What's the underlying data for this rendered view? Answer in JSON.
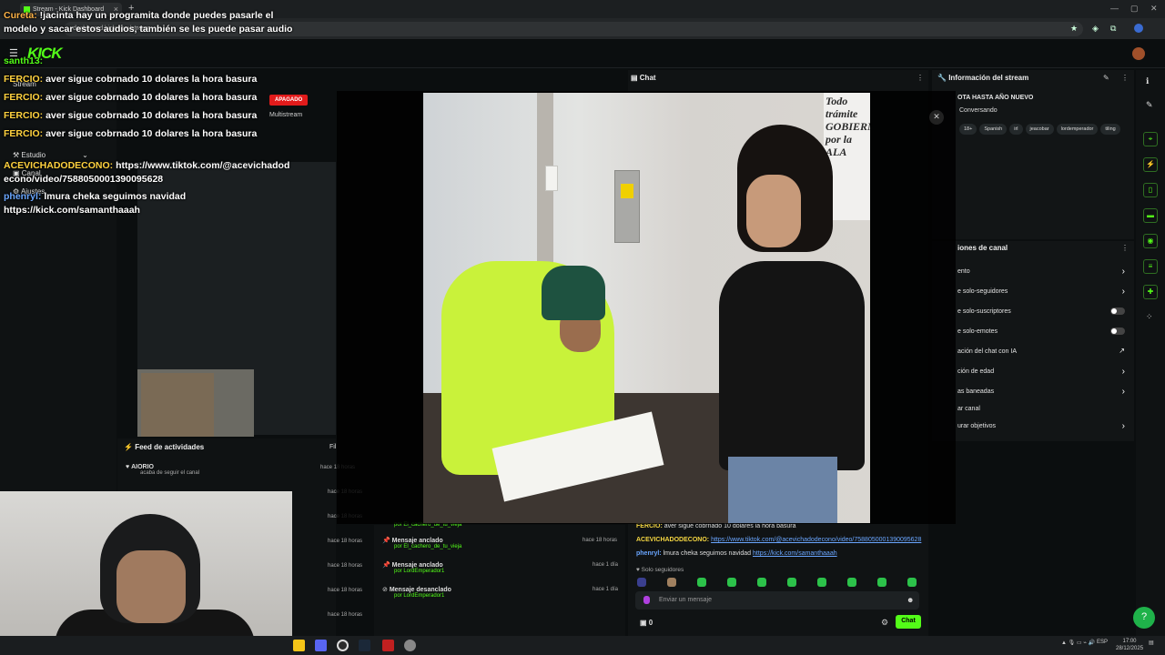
{
  "browser": {
    "tab_title": "Stream - Kick Dashboard",
    "url": "dashboard.kick.com/stream",
    "window_controls": [
      "—",
      "▢",
      "✕"
    ]
  },
  "kick": {
    "logo": "KICK",
    "sidebar": [
      {
        "label": "Stream"
      },
      {
        "label": "Estudio"
      },
      {
        "label": "Canal"
      },
      {
        "label": "Ajustes"
      }
    ],
    "status_badge": "APAGADO",
    "multistream_label": "Multistream",
    "activity_feed": {
      "title": "Feed de actividades",
      "filter": "Fil",
      "items": [
        {
          "name": "AIORIO",
          "desc": "acaba de seguir el canal",
          "time": "hace 18 horas"
        },
        {
          "name": "",
          "desc": "",
          "time": "hace 18 horas"
        },
        {
          "name": "",
          "desc": "",
          "time": "hace 18 horas"
        },
        {
          "name": "",
          "desc": "",
          "time": "hace 18 horas"
        },
        {
          "name": "",
          "desc": "",
          "time": "hace 18 horas"
        },
        {
          "name": "",
          "desc": "",
          "time": "hace 18 horas"
        },
        {
          "name": "",
          "desc": "",
          "time": "hace 18 horas"
        }
      ]
    },
    "pinned": [
      {
        "title": "",
        "by": "por El_cachero_de_tu_vieja",
        "time": ""
      },
      {
        "title": "Mensaje anclado",
        "by": "por El_cachero_de_tu_vieja",
        "time": "hace 18 horas"
      },
      {
        "title": "Mensaje anclado",
        "by": "por LordEmperador1",
        "time": "hace 1 día"
      },
      {
        "title": "Mensaje desanclado",
        "by": "por LordEmperador1",
        "time": "hace 1 día"
      }
    ],
    "chat": {
      "title": "Chat",
      "lines": [
        {
          "user": "FERCIO:",
          "text": " aver sigue cobrnado 10 dolares la hora basura",
          "link": ""
        },
        {
          "user": "ACEVICHADODECONO:",
          "text": " ",
          "link": "https://www.tiktok.com/@acevichadodecono/video/7588050001390095628"
        },
        {
          "user": "phenryl:",
          "text": " lmura cheka seguimos navidad ",
          "link": "https://kick.com/samanthaaah"
        }
      ],
      "mode": "Solo seguidores",
      "input_placeholder": "Enviar un mensaje",
      "count": "0",
      "send_button": "Chat"
    },
    "stream_info": {
      "title": "Información del stream",
      "stream_title": "OTA HASTA AÑO NUEVO",
      "category": "Conversando",
      "tags": [
        "18+",
        "Spanish",
        "irl",
        "jeacobar",
        "lordemperador",
        "tiling"
      ]
    },
    "channel_settings": {
      "title": "iones de canal",
      "rows": [
        {
          "label": "ento",
          "control": "chevron"
        },
        {
          "label": "e solo-seguidores",
          "control": "chevron"
        },
        {
          "label": "e solo-suscriptores",
          "control": "toggle"
        },
        {
          "label": "e solo-emotes",
          "control": "toggle"
        },
        {
          "label": "ación del chat con IA",
          "control": "external"
        },
        {
          "label": "ción de edad",
          "control": "chevron"
        },
        {
          "label": "as baneadas",
          "control": "chevron"
        },
        {
          "label": "ar canal",
          "control": "none"
        },
        {
          "label": "urar objetivos",
          "control": "chevron"
        }
      ]
    }
  },
  "modal": {
    "close": "✕",
    "poster_text": "Todo trámite GOBIERNO por la ALA"
  },
  "overlay_chat": [
    {
      "user": "Cureta:",
      "text": " !jacinta hay un programita donde puedes pasarle el modelo y sacar estos audios, también se les puede pasar audio",
      "cls": "n1"
    },
    {
      "user": "santh13:",
      "text": "",
      "cls": "n4"
    },
    {
      "user": "FERCIO:",
      "text": " aver sigue cobrnado 10 dolares la hora basura",
      "cls": "n2"
    },
    {
      "user": "FERCIO:",
      "text": " aver sigue cobrnado 10 dolares la hora basura",
      "cls": "n2"
    },
    {
      "user": "FERCIO:",
      "text": " aver sigue cobrnado 10 dolares la hora basura",
      "cls": "n2"
    },
    {
      "user": "FERCIO:",
      "text": " aver sigue cobrnado 10 dolares la hora basura",
      "cls": "n2"
    },
    {
      "user": "ACEVICHADODECONO:",
      "text": " https://www.tiktok.com/@acevichadodecono/video/7588050001390095628",
      "cls": "n2"
    },
    {
      "user": "phenryl:",
      "text": " lmura cheka seguimos navidad https://kick.com/samanthaaah",
      "cls": "n3"
    }
  ],
  "taskbar": {
    "lang": "ESP",
    "time": "17:00",
    "date": "28/12/2025"
  },
  "colors": {
    "accent": "#53fc18",
    "danger": "#e21b1b",
    "bg": "#0b0e0f"
  }
}
